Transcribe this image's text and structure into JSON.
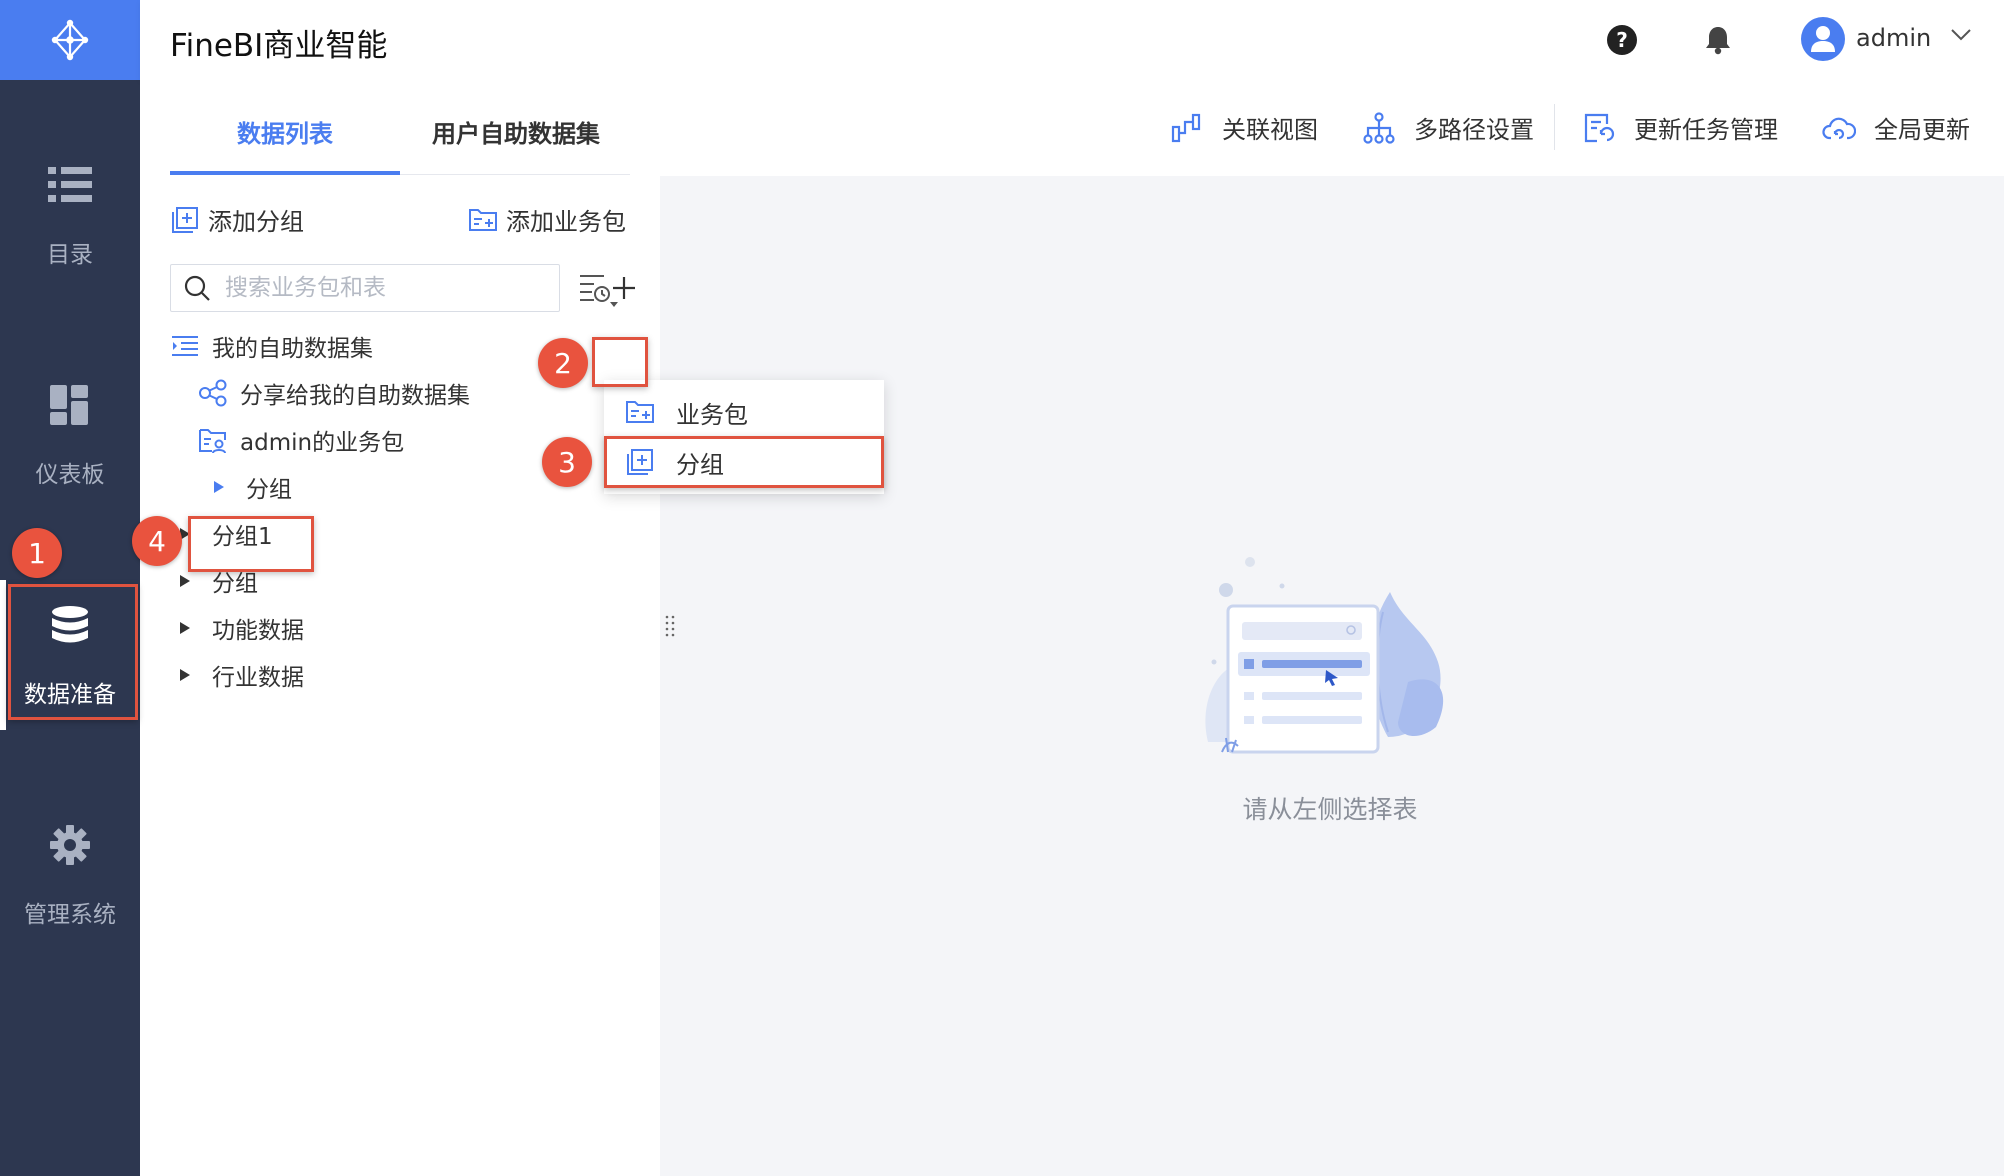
{
  "app": {
    "title": "FineBI商业智能"
  },
  "colors": {
    "brand": "#4a7df0",
    "nav_bg": "#2d3750",
    "annotation": "#e9533e"
  },
  "nav": {
    "items": [
      {
        "label": "目录",
        "icon": "list-icon"
      },
      {
        "label": "仪表板",
        "icon": "dashboard-icon"
      },
      {
        "label": "数据准备",
        "icon": "database-icon",
        "active": true
      },
      {
        "label": "管理系统",
        "icon": "gear-icon"
      }
    ]
  },
  "header": {
    "help_icon": "help-icon",
    "bell_icon": "bell-icon",
    "user": {
      "name": "admin"
    }
  },
  "tabs": [
    {
      "label": "数据列表",
      "active": true
    },
    {
      "label": "用户自助数据集",
      "active": false
    }
  ],
  "toolbar": {
    "items": [
      {
        "label": "关联视图",
        "icon": "relation-view-icon"
      },
      {
        "label": "多路径设置",
        "icon": "multipath-icon"
      },
      {
        "label": "更新任务管理",
        "icon": "update-task-icon"
      },
      {
        "label": "全局更新",
        "icon": "cloud-refresh-icon"
      }
    ]
  },
  "panel": {
    "add_group": "添加分组",
    "add_package": "添加业务包",
    "search": {
      "placeholder": "搜索业务包和表",
      "value": ""
    },
    "tree": [
      {
        "label": "我的自助数据集",
        "icon": "dataset-list-icon"
      },
      {
        "label": "分享给我的自助数据集",
        "icon": "share-icon"
      },
      {
        "label": "admin的业务包",
        "icon": "user-package-icon"
      },
      {
        "label": "分组",
        "expanded": false,
        "highlighted": true
      },
      {
        "label": "分组1"
      },
      {
        "label": "分组"
      },
      {
        "label": "功能数据"
      },
      {
        "label": "行业数据"
      }
    ]
  },
  "dropdown": {
    "items": [
      {
        "label": "业务包",
        "icon": "package-icon"
      },
      {
        "label": "分组",
        "icon": "add-group-icon"
      }
    ]
  },
  "main": {
    "empty_text": "请从左侧选择表"
  },
  "annotations": [
    "1",
    "2",
    "3",
    "4"
  ]
}
